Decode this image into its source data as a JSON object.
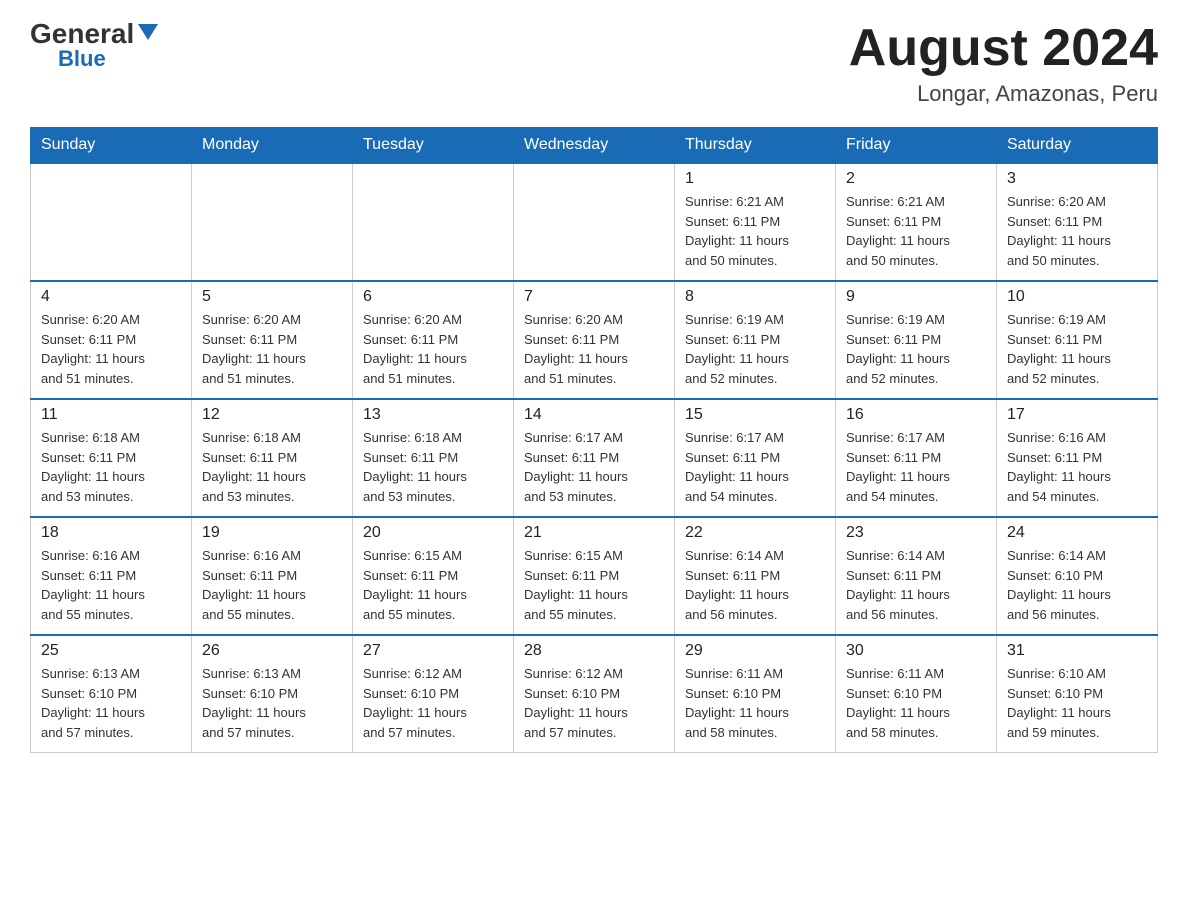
{
  "logo": {
    "general": "General",
    "blue": "Blue"
  },
  "header": {
    "month": "August 2024",
    "location": "Longar, Amazonas, Peru"
  },
  "weekdays": [
    "Sunday",
    "Monday",
    "Tuesday",
    "Wednesday",
    "Thursday",
    "Friday",
    "Saturday"
  ],
  "weeks": [
    [
      {
        "day": "",
        "info": ""
      },
      {
        "day": "",
        "info": ""
      },
      {
        "day": "",
        "info": ""
      },
      {
        "day": "",
        "info": ""
      },
      {
        "day": "1",
        "info": "Sunrise: 6:21 AM\nSunset: 6:11 PM\nDaylight: 11 hours\nand 50 minutes."
      },
      {
        "day": "2",
        "info": "Sunrise: 6:21 AM\nSunset: 6:11 PM\nDaylight: 11 hours\nand 50 minutes."
      },
      {
        "day": "3",
        "info": "Sunrise: 6:20 AM\nSunset: 6:11 PM\nDaylight: 11 hours\nand 50 minutes."
      }
    ],
    [
      {
        "day": "4",
        "info": "Sunrise: 6:20 AM\nSunset: 6:11 PM\nDaylight: 11 hours\nand 51 minutes."
      },
      {
        "day": "5",
        "info": "Sunrise: 6:20 AM\nSunset: 6:11 PM\nDaylight: 11 hours\nand 51 minutes."
      },
      {
        "day": "6",
        "info": "Sunrise: 6:20 AM\nSunset: 6:11 PM\nDaylight: 11 hours\nand 51 minutes."
      },
      {
        "day": "7",
        "info": "Sunrise: 6:20 AM\nSunset: 6:11 PM\nDaylight: 11 hours\nand 51 minutes."
      },
      {
        "day": "8",
        "info": "Sunrise: 6:19 AM\nSunset: 6:11 PM\nDaylight: 11 hours\nand 52 minutes."
      },
      {
        "day": "9",
        "info": "Sunrise: 6:19 AM\nSunset: 6:11 PM\nDaylight: 11 hours\nand 52 minutes."
      },
      {
        "day": "10",
        "info": "Sunrise: 6:19 AM\nSunset: 6:11 PM\nDaylight: 11 hours\nand 52 minutes."
      }
    ],
    [
      {
        "day": "11",
        "info": "Sunrise: 6:18 AM\nSunset: 6:11 PM\nDaylight: 11 hours\nand 53 minutes."
      },
      {
        "day": "12",
        "info": "Sunrise: 6:18 AM\nSunset: 6:11 PM\nDaylight: 11 hours\nand 53 minutes."
      },
      {
        "day": "13",
        "info": "Sunrise: 6:18 AM\nSunset: 6:11 PM\nDaylight: 11 hours\nand 53 minutes."
      },
      {
        "day": "14",
        "info": "Sunrise: 6:17 AM\nSunset: 6:11 PM\nDaylight: 11 hours\nand 53 minutes."
      },
      {
        "day": "15",
        "info": "Sunrise: 6:17 AM\nSunset: 6:11 PM\nDaylight: 11 hours\nand 54 minutes."
      },
      {
        "day": "16",
        "info": "Sunrise: 6:17 AM\nSunset: 6:11 PM\nDaylight: 11 hours\nand 54 minutes."
      },
      {
        "day": "17",
        "info": "Sunrise: 6:16 AM\nSunset: 6:11 PM\nDaylight: 11 hours\nand 54 minutes."
      }
    ],
    [
      {
        "day": "18",
        "info": "Sunrise: 6:16 AM\nSunset: 6:11 PM\nDaylight: 11 hours\nand 55 minutes."
      },
      {
        "day": "19",
        "info": "Sunrise: 6:16 AM\nSunset: 6:11 PM\nDaylight: 11 hours\nand 55 minutes."
      },
      {
        "day": "20",
        "info": "Sunrise: 6:15 AM\nSunset: 6:11 PM\nDaylight: 11 hours\nand 55 minutes."
      },
      {
        "day": "21",
        "info": "Sunrise: 6:15 AM\nSunset: 6:11 PM\nDaylight: 11 hours\nand 55 minutes."
      },
      {
        "day": "22",
        "info": "Sunrise: 6:14 AM\nSunset: 6:11 PM\nDaylight: 11 hours\nand 56 minutes."
      },
      {
        "day": "23",
        "info": "Sunrise: 6:14 AM\nSunset: 6:11 PM\nDaylight: 11 hours\nand 56 minutes."
      },
      {
        "day": "24",
        "info": "Sunrise: 6:14 AM\nSunset: 6:10 PM\nDaylight: 11 hours\nand 56 minutes."
      }
    ],
    [
      {
        "day": "25",
        "info": "Sunrise: 6:13 AM\nSunset: 6:10 PM\nDaylight: 11 hours\nand 57 minutes."
      },
      {
        "day": "26",
        "info": "Sunrise: 6:13 AM\nSunset: 6:10 PM\nDaylight: 11 hours\nand 57 minutes."
      },
      {
        "day": "27",
        "info": "Sunrise: 6:12 AM\nSunset: 6:10 PM\nDaylight: 11 hours\nand 57 minutes."
      },
      {
        "day": "28",
        "info": "Sunrise: 6:12 AM\nSunset: 6:10 PM\nDaylight: 11 hours\nand 57 minutes."
      },
      {
        "day": "29",
        "info": "Sunrise: 6:11 AM\nSunset: 6:10 PM\nDaylight: 11 hours\nand 58 minutes."
      },
      {
        "day": "30",
        "info": "Sunrise: 6:11 AM\nSunset: 6:10 PM\nDaylight: 11 hours\nand 58 minutes."
      },
      {
        "day": "31",
        "info": "Sunrise: 6:10 AM\nSunset: 6:10 PM\nDaylight: 11 hours\nand 59 minutes."
      }
    ]
  ]
}
